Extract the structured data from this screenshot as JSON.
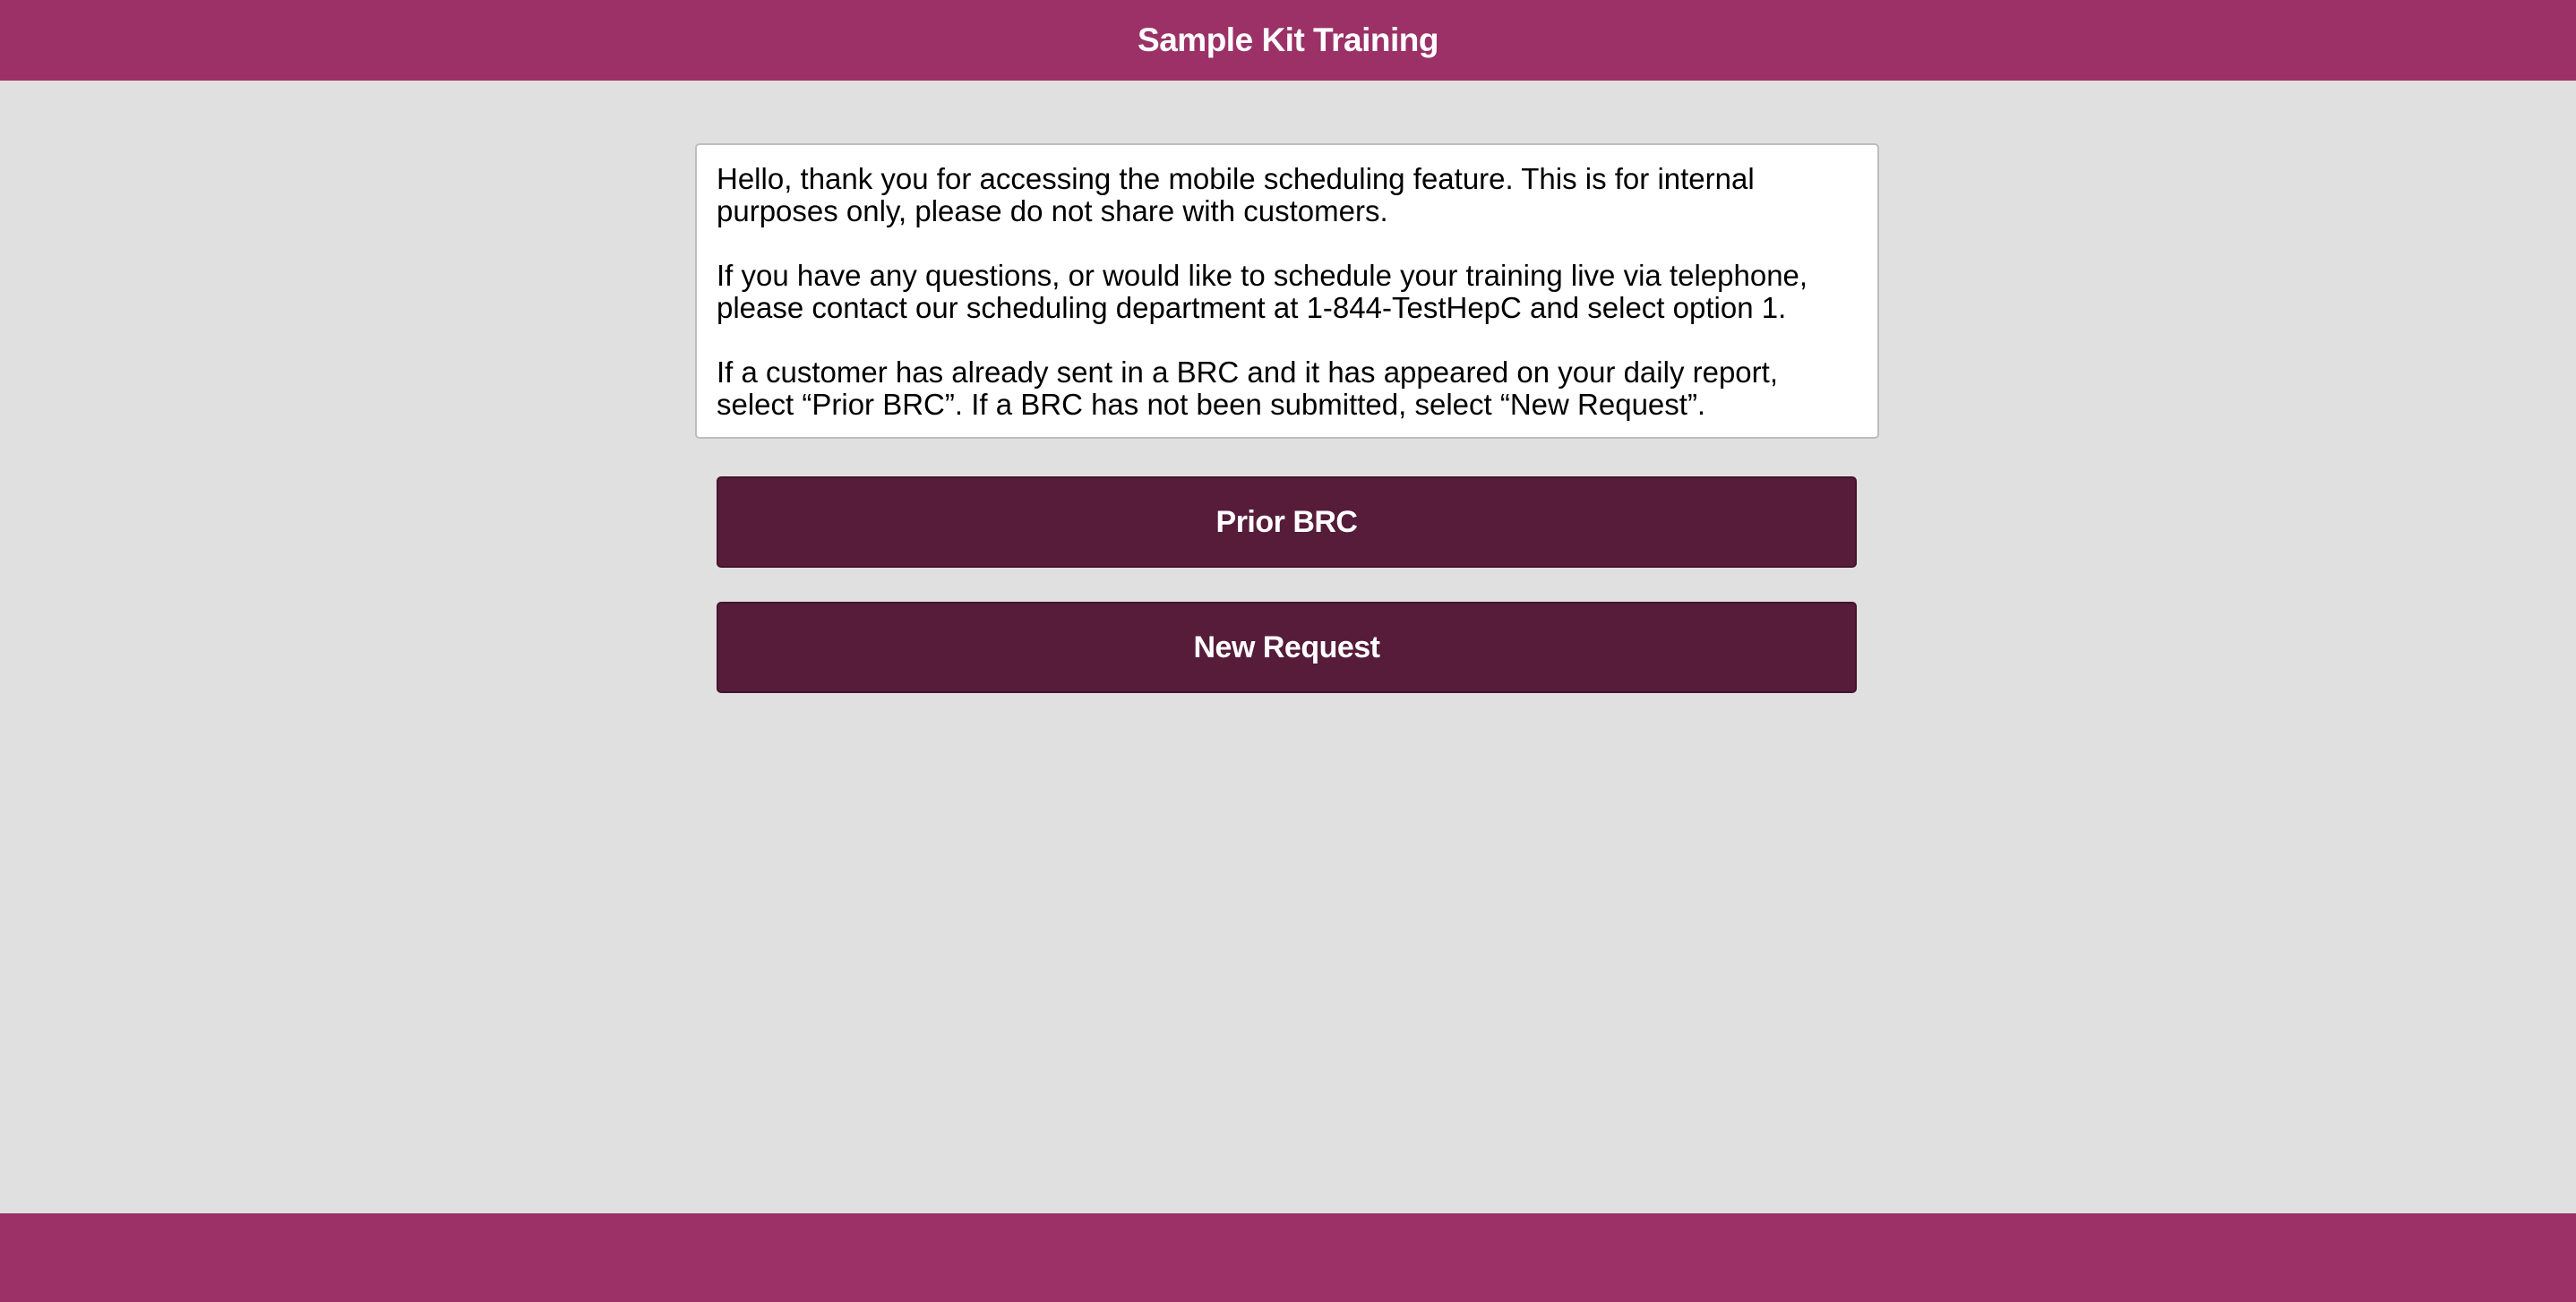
{
  "header": {
    "title": "Sample Kit Training"
  },
  "info": {
    "paragraphs": [
      "Hello, thank you for accessing the mobile scheduling feature. This is for internal purposes only, please do not share with customers.",
      "If you have any questions, or would like to schedule your training live via telephone, please contact our scheduling department at 1-844-TestHepC and select option 1.",
      "If a customer has already sent in a BRC and it has appeared on your daily report, select “Prior BRC”. If a BRC has not been submitted, select “New Request”."
    ]
  },
  "actions": {
    "prior_brc_label": "Prior BRC",
    "new_request_label": "New Request"
  },
  "colors": {
    "brand": "#9b3166",
    "button": "#561c3a",
    "background": "#e0e0e0"
  }
}
